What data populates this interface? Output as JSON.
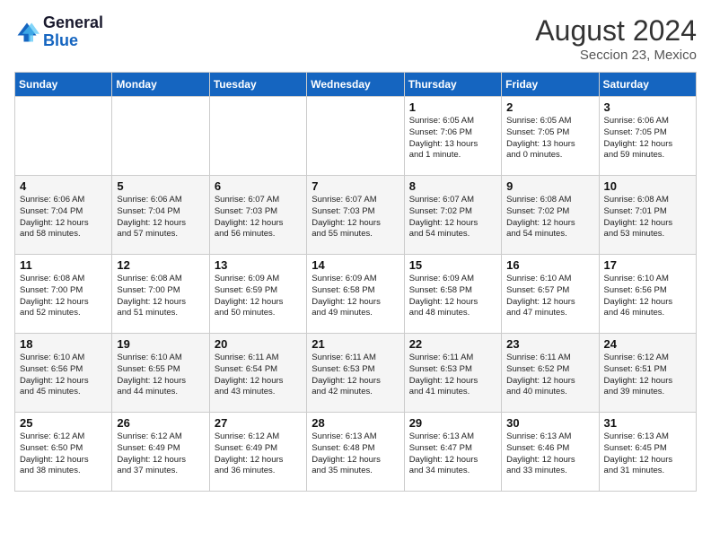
{
  "header": {
    "logo_line1": "General",
    "logo_line2": "Blue",
    "month_year": "August 2024",
    "location": "Seccion 23, Mexico"
  },
  "days_of_week": [
    "Sunday",
    "Monday",
    "Tuesday",
    "Wednesday",
    "Thursday",
    "Friday",
    "Saturday"
  ],
  "weeks": [
    [
      {
        "day": "",
        "detail": ""
      },
      {
        "day": "",
        "detail": ""
      },
      {
        "day": "",
        "detail": ""
      },
      {
        "day": "",
        "detail": ""
      },
      {
        "day": "1",
        "detail": "Sunrise: 6:05 AM\nSunset: 7:06 PM\nDaylight: 13 hours\nand 1 minute."
      },
      {
        "day": "2",
        "detail": "Sunrise: 6:05 AM\nSunset: 7:05 PM\nDaylight: 13 hours\nand 0 minutes."
      },
      {
        "day": "3",
        "detail": "Sunrise: 6:06 AM\nSunset: 7:05 PM\nDaylight: 12 hours\nand 59 minutes."
      }
    ],
    [
      {
        "day": "4",
        "detail": "Sunrise: 6:06 AM\nSunset: 7:04 PM\nDaylight: 12 hours\nand 58 minutes."
      },
      {
        "day": "5",
        "detail": "Sunrise: 6:06 AM\nSunset: 7:04 PM\nDaylight: 12 hours\nand 57 minutes."
      },
      {
        "day": "6",
        "detail": "Sunrise: 6:07 AM\nSunset: 7:03 PM\nDaylight: 12 hours\nand 56 minutes."
      },
      {
        "day": "7",
        "detail": "Sunrise: 6:07 AM\nSunset: 7:03 PM\nDaylight: 12 hours\nand 55 minutes."
      },
      {
        "day": "8",
        "detail": "Sunrise: 6:07 AM\nSunset: 7:02 PM\nDaylight: 12 hours\nand 54 minutes."
      },
      {
        "day": "9",
        "detail": "Sunrise: 6:08 AM\nSunset: 7:02 PM\nDaylight: 12 hours\nand 54 minutes."
      },
      {
        "day": "10",
        "detail": "Sunrise: 6:08 AM\nSunset: 7:01 PM\nDaylight: 12 hours\nand 53 minutes."
      }
    ],
    [
      {
        "day": "11",
        "detail": "Sunrise: 6:08 AM\nSunset: 7:00 PM\nDaylight: 12 hours\nand 52 minutes."
      },
      {
        "day": "12",
        "detail": "Sunrise: 6:08 AM\nSunset: 7:00 PM\nDaylight: 12 hours\nand 51 minutes."
      },
      {
        "day": "13",
        "detail": "Sunrise: 6:09 AM\nSunset: 6:59 PM\nDaylight: 12 hours\nand 50 minutes."
      },
      {
        "day": "14",
        "detail": "Sunrise: 6:09 AM\nSunset: 6:58 PM\nDaylight: 12 hours\nand 49 minutes."
      },
      {
        "day": "15",
        "detail": "Sunrise: 6:09 AM\nSunset: 6:58 PM\nDaylight: 12 hours\nand 48 minutes."
      },
      {
        "day": "16",
        "detail": "Sunrise: 6:10 AM\nSunset: 6:57 PM\nDaylight: 12 hours\nand 47 minutes."
      },
      {
        "day": "17",
        "detail": "Sunrise: 6:10 AM\nSunset: 6:56 PM\nDaylight: 12 hours\nand 46 minutes."
      }
    ],
    [
      {
        "day": "18",
        "detail": "Sunrise: 6:10 AM\nSunset: 6:56 PM\nDaylight: 12 hours\nand 45 minutes."
      },
      {
        "day": "19",
        "detail": "Sunrise: 6:10 AM\nSunset: 6:55 PM\nDaylight: 12 hours\nand 44 minutes."
      },
      {
        "day": "20",
        "detail": "Sunrise: 6:11 AM\nSunset: 6:54 PM\nDaylight: 12 hours\nand 43 minutes."
      },
      {
        "day": "21",
        "detail": "Sunrise: 6:11 AM\nSunset: 6:53 PM\nDaylight: 12 hours\nand 42 minutes."
      },
      {
        "day": "22",
        "detail": "Sunrise: 6:11 AM\nSunset: 6:53 PM\nDaylight: 12 hours\nand 41 minutes."
      },
      {
        "day": "23",
        "detail": "Sunrise: 6:11 AM\nSunset: 6:52 PM\nDaylight: 12 hours\nand 40 minutes."
      },
      {
        "day": "24",
        "detail": "Sunrise: 6:12 AM\nSunset: 6:51 PM\nDaylight: 12 hours\nand 39 minutes."
      }
    ],
    [
      {
        "day": "25",
        "detail": "Sunrise: 6:12 AM\nSunset: 6:50 PM\nDaylight: 12 hours\nand 38 minutes."
      },
      {
        "day": "26",
        "detail": "Sunrise: 6:12 AM\nSunset: 6:49 PM\nDaylight: 12 hours\nand 37 minutes."
      },
      {
        "day": "27",
        "detail": "Sunrise: 6:12 AM\nSunset: 6:49 PM\nDaylight: 12 hours\nand 36 minutes."
      },
      {
        "day": "28",
        "detail": "Sunrise: 6:13 AM\nSunset: 6:48 PM\nDaylight: 12 hours\nand 35 minutes."
      },
      {
        "day": "29",
        "detail": "Sunrise: 6:13 AM\nSunset: 6:47 PM\nDaylight: 12 hours\nand 34 minutes."
      },
      {
        "day": "30",
        "detail": "Sunrise: 6:13 AM\nSunset: 6:46 PM\nDaylight: 12 hours\nand 33 minutes."
      },
      {
        "day": "31",
        "detail": "Sunrise: 6:13 AM\nSunset: 6:45 PM\nDaylight: 12 hours\nand 31 minutes."
      }
    ]
  ]
}
